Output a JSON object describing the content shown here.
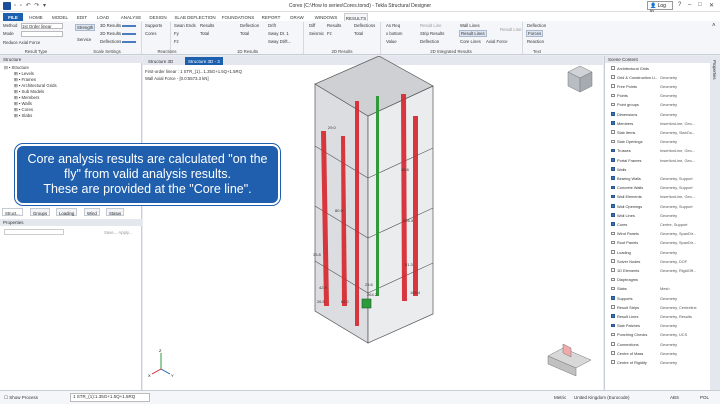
{
  "app": {
    "title": "Cores (C:\\How to series\\Cores.torsd) - Tekla Structural Designer",
    "login": "Log in"
  },
  "menu_tabs": [
    "FILE",
    "HOME",
    "MODEL",
    "EDIT",
    "LOAD",
    "ANALYSE",
    "DESIGN",
    "SLAB DEFLECTION",
    "FOUNDATIONS",
    "REPORT",
    "DRAW",
    "WINDOWS",
    "RESULTS"
  ],
  "ribbon": {
    "method_label": "Method",
    "method_value": "1st Order linear",
    "mode_label": "Mode",
    "reduce": "Reduce Axial Force",
    "strength": "Strength",
    "service": "Service",
    "r3d": "3D Results",
    "r2d": "2D Results",
    "deflections": "Deflections",
    "supports": "Supports",
    "cores": "Cores",
    "swan": "Swan Ends",
    "results": "Results",
    "total": "Total",
    "fy": "Fy",
    "fz": "Fz",
    "deflection": "Deflection",
    "drift": "Drift",
    "sway": "Sway Dr. 1",
    "sway_drift": "Sway Drift...",
    "diff": "Diff",
    "seismic": "Seismic",
    "deflections2": "Deflections",
    "as_req": "As Req",
    "x_bottom": "x bottom",
    "value": "Value",
    "result_line": "Result Line",
    "strip_results": "Strip Results",
    "deflection2": "Deflection",
    "wall_lines": "Wall Lines",
    "result_lines": "Result Lines",
    "core_lines": "Core Lines",
    "axial_force": "Axial Force",
    "deflection3": "Deflection",
    "forces": "Forces",
    "reaction": "Reaction",
    "groups": [
      "Result Type",
      "Scale Settings",
      "Reactions",
      "1D Results",
      "2D Results",
      "2D Integrated Results",
      "Text"
    ]
  },
  "structure_panel": {
    "title": "Structure",
    "items": [
      "Structure",
      "Levels",
      "Frames",
      "Architectural Grids",
      "Sub Models",
      "Members",
      "Walls",
      "Cores",
      "Slabs"
    ]
  },
  "left_tabs": [
    "Struct...",
    "Groups",
    "Loading",
    "Wind",
    "Status"
  ],
  "properties": {
    "title": "Properties",
    "placeholder": "Save... Apply..."
  },
  "view_tabs": [
    "Structure 3D",
    "Structure 3D - 3"
  ],
  "viewport": {
    "line1": "First-order linear : 1 STR_(1)...1.35G+1.5Q+1.5RQ",
    "line2": "Wall Axial Force - [0.0:5573.3 kN]",
    "labels": [
      "29.0",
      "40.8",
      "80.9",
      "226.3",
      "33.8",
      "42.9",
      "51.3",
      "25.6",
      "264.2",
      "26.5",
      "62.2",
      "165.4"
    ]
  },
  "callout": {
    "line1": "Core analysis results are calculated \"on the",
    "line2": "fly\" from valid analysis results.",
    "line3": "These are provided at the \"Core line\"."
  },
  "scene_content": {
    "title": "Scene Content",
    "items": [
      {
        "name": "Architectural Grids",
        "type": "",
        "checked": false
      },
      {
        "name": "Grid & Construction Li...",
        "type": "Geometry",
        "checked": false
      },
      {
        "name": "Free Points",
        "type": "Geometry",
        "checked": false
      },
      {
        "name": "Points",
        "type": "Geometry",
        "checked": false
      },
      {
        "name": "Point groups",
        "type": "Geometry",
        "checked": false
      },
      {
        "name": "Dimensions",
        "type": "Geometry",
        "checked": true
      },
      {
        "name": "Members",
        "type": "InsertionLine, Geo...",
        "checked": true
      },
      {
        "name": "Slab Items",
        "type": "Geometry, SlabOu...",
        "checked": false
      },
      {
        "name": "Slab Openings",
        "type": "Geometry",
        "checked": false
      },
      {
        "name": "Trusses",
        "type": "InsertionLine, Geo...",
        "checked": true
      },
      {
        "name": "Portal Frames",
        "type": "InsertionLine, Geo...",
        "checked": true
      },
      {
        "name": "Walls",
        "type": "",
        "checked": true
      },
      {
        "name": "Bearing Walls",
        "type": "Geometry, Support",
        "checked": true
      },
      {
        "name": "Concrete Walls",
        "type": "Geometry, Support",
        "checked": true
      },
      {
        "name": "Wall Elements",
        "type": "InsertionLine, Geo...",
        "checked": true
      },
      {
        "name": "Wall Openings",
        "type": "Geometry, Support",
        "checked": true
      },
      {
        "name": "Wall Lines",
        "type": "Geometry",
        "checked": true
      },
      {
        "name": "Cores",
        "type": "Centre, Support",
        "checked": true
      },
      {
        "name": "Wind Panels",
        "type": "Geometry, SpanDir...",
        "checked": false
      },
      {
        "name": "Roof Panels",
        "type": "Geometry, SpanDir...",
        "checked": false
      },
      {
        "name": "Loading",
        "type": "Geometry",
        "checked": false
      },
      {
        "name": "Solver Nodes",
        "type": "Geometry, DOF",
        "checked": false
      },
      {
        "name": "1D Elements",
        "type": "Geometry, RigidOff...",
        "checked": false
      },
      {
        "name": "Diaphragms",
        "type": "",
        "checked": false
      },
      {
        "name": "Slabs",
        "type": "Mesh",
        "checked": false
      },
      {
        "name": "Supports",
        "type": "Geometry",
        "checked": true
      },
      {
        "name": "Result Strips",
        "type": "Geometry, Centreline",
        "checked": false
      },
      {
        "name": "Result Lines",
        "type": "Geometry, Results",
        "checked": true
      },
      {
        "name": "Slab Patches",
        "type": "Geometry",
        "checked": true
      },
      {
        "name": "Punching Checks",
        "type": "Geometry, UCS",
        "checked": false
      },
      {
        "name": "Connections",
        "type": "Geometry",
        "checked": false
      },
      {
        "name": "Centre of Mass",
        "type": "Geometry",
        "checked": false
      },
      {
        "name": "Centre of Rigidity",
        "type": "Geometry",
        "checked": false
      }
    ]
  },
  "right_sidebar": "Properties",
  "status": {
    "show_process": "Show Process",
    "combo": "1 STR_(1):1.35G+1.5Q+1.5RQ",
    "units": "Metric",
    "locale": "United Kingdom (Eurocode)",
    "abs": "ABS",
    "pol": "POL"
  },
  "colors": {
    "accent": "#1b5fae",
    "result_red": "#d6242b",
    "green": "#2f9a3c"
  }
}
